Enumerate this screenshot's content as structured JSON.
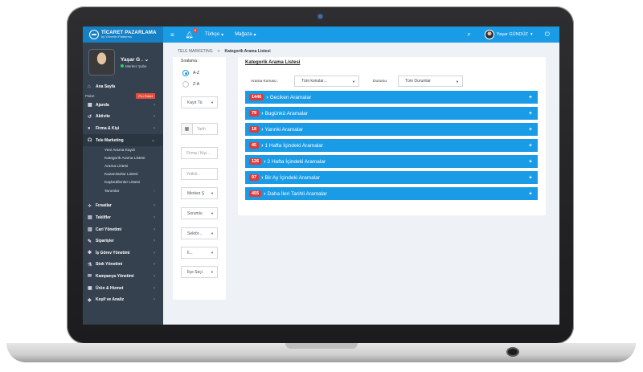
{
  "topbar": {
    "brand_title": "TİCARET PAZARLAMA",
    "brand_sub": "by Yönetim Platformu",
    "bell_count": "8",
    "language": "Türkçe",
    "store": "Mağaza",
    "user_name": "Yaşar GÜNDÜZ"
  },
  "profile": {
    "name": "Yaşar G .",
    "branch": "Merkez Şube"
  },
  "sidebar": {
    "home": "Ana Sayfa",
    "paket": "Paket",
    "pro_badge": "Pro Paket",
    "items_top": [
      "Ajanda",
      "Aktivite",
      "Firma & Kişi",
      "Tele Marketing"
    ],
    "sub_items": [
      "Yeni Arama Kaydı",
      "Kategorik Arama Listesi",
      "Arama Listesi",
      "Kazanılanlar Listesi",
      "Kaybedilenler Listesi",
      "Tanımlar"
    ],
    "items_bottom": [
      "Fırsatlar",
      "Teklifler",
      "Cari Yönetimi",
      "Siparişler",
      "İş Görev Yönetimi",
      "Stok Yönetimi",
      "Kampanya Yönetimi",
      "Ürün & Hizmet",
      "Keşif ve Analiz"
    ]
  },
  "breadcrumb": {
    "parent": "TELE MARKETING",
    "separator": ">",
    "current": "Kategorik Arama Listesi"
  },
  "filters": {
    "sort_label": "Sıralama :",
    "sort_az": "A-Z",
    "sort_za": "Z-A",
    "record_type": "Kayıt Tü",
    "date_placeholder": "Tarih",
    "company_placeholder": "Firma / Kişi...",
    "authorized_placeholder": "Yetkili...",
    "branch": "Merkez Ş",
    "responsible": "Sorumlu",
    "sector": "Sektör...",
    "city": "İl...",
    "district": "İlçe Seçi"
  },
  "panel": {
    "title": "Kategorik Arama Listesi",
    "subject_label": "Arama Konusu :",
    "subject_value": "Tüm konular...",
    "status_label": "Durumu",
    "status_value": "Tüm Durumlar",
    "rows": [
      {
        "count": "1446",
        "label": "Geciken Aramalar"
      },
      {
        "count": "79",
        "label": "Bugünkü Aramalar"
      },
      {
        "count": "18",
        "label": "Yarınki Aramalar"
      },
      {
        "count": "45",
        "label": "1 Hafta İçindeki Aramalar"
      },
      {
        "count": "126",
        "label": "2 Hafta İçindeki Aramalar"
      },
      {
        "count": "97",
        "label": "Bir Ay İçindeki Aramalar"
      },
      {
        "count": "455",
        "label": "Daha İleri Tarihli Aramalar"
      }
    ]
  },
  "colors": {
    "primary": "#1a9be6",
    "sidebar": "#364150",
    "badge": "#e03b3b"
  }
}
